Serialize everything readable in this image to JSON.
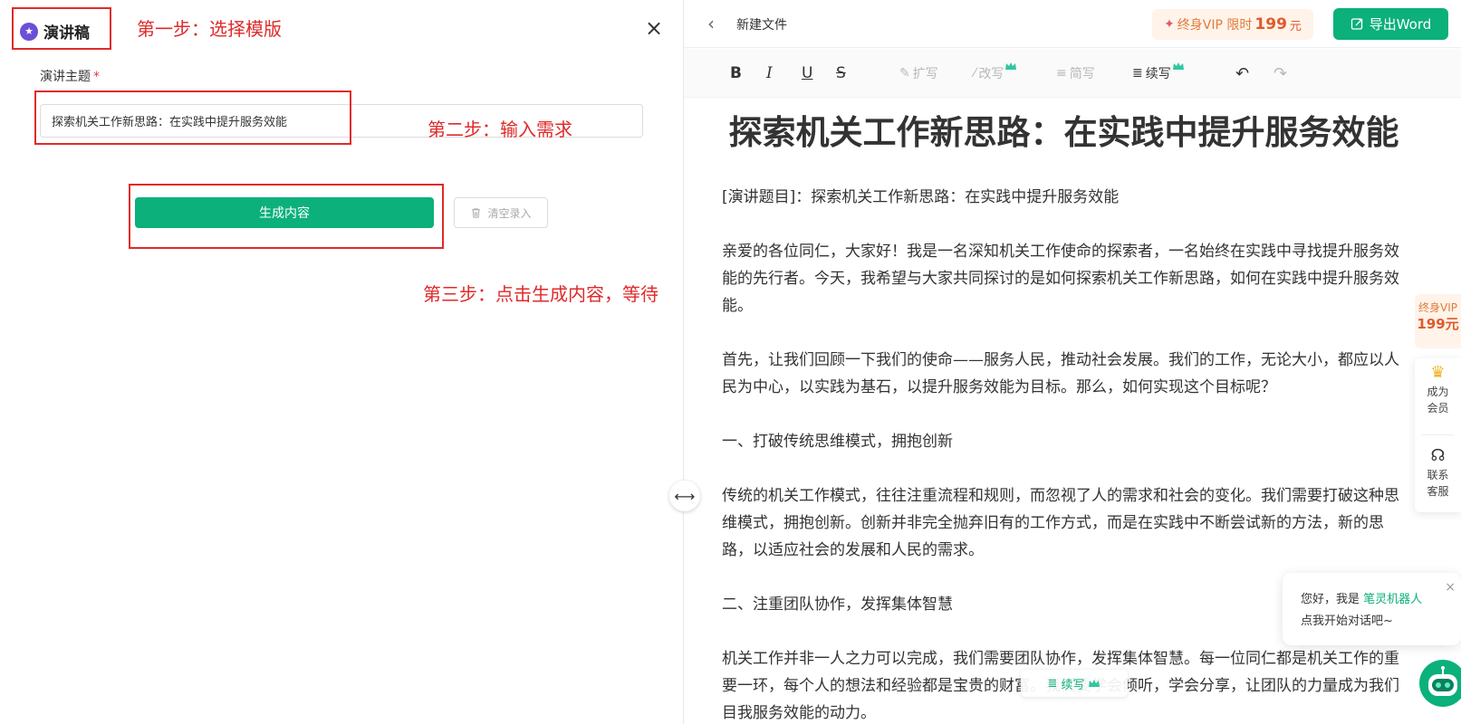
{
  "left_panel": {
    "brand": "演讲稿",
    "field_label": "演讲主题",
    "required_mark": "*",
    "topic_value": "探索机关工作新思路：在实践中提升服务效能",
    "generate_label": "生成内容",
    "clear_label": "清空录入"
  },
  "annotations": {
    "step1": "第一步：选择模版",
    "step2": "第二步：输入需求",
    "step3": "第三步：点击生成内容，等待"
  },
  "topbar": {
    "doc_title": "新建文件",
    "vip_text": "终身VIP 限时",
    "vip_price": "199",
    "vip_unit": "元",
    "export_label": "导出Word"
  },
  "toolbar": {
    "bold": "B",
    "italic": "I",
    "underline": "U",
    "strike": "S",
    "expand": "扩写",
    "rewrite": "改写",
    "shorten": "简写",
    "continue": "续写"
  },
  "document": {
    "title": "探索机关工作新思路：在实践中提升服务效能",
    "paragraphs": [
      "[演讲题目]：探索机关工作新思路：在实践中提升服务效能",
      "亲爱的各位同仁，大家好！我是一名深知机关工作使命的探索者，一名始终在实践中寻找提升服务效能的先行者。今天，我希望与大家共同探讨的是如何探索机关工作新思路，如何在实践中提升服务效能。",
      "首先，让我们回顾一下我们的使命——服务人民，推动社会发展。我们的工作，无论大小，都应以人民为中心，以实践为基石，以提升服务效能为目标。那么，如何实现这个目标呢？",
      "一、打破传统思维模式，拥抱创新",
      "传统的机关工作模式，往往注重流程和规则，而忽视了人的需求和社会的变化。我们需要打破这种思维模式，拥抱创新。创新并非完全抛弃旧有的工作方式，而是在实践中不断尝试新的方法，新的思路，以适应社会的发展和人民的需求。",
      "二、注重团队协作，发挥集体智慧",
      "机关工作并非一人之力可以完成，我们需要团队协作，发挥集体智慧。每一位同仁都是机关工作的重要一环，每个人的想法和经验都是宝贵的财富。我们要学会倾听，学会分享，让团队的力量成为我们目我服务效能的动力。"
    ]
  },
  "floating": {
    "vip_line1": "终身VIP",
    "vip_price": "199元",
    "member_line1": "成为",
    "member_line2": "会员",
    "service_line1": "联系",
    "service_line2": "客服",
    "chat_greeting": "您好，我是",
    "chat_name": "笔灵机器人",
    "chat_line2": "点我开始对话吧~",
    "continue_chip": "续写"
  },
  "colors": {
    "accent": "#0bb07b",
    "annotation_red": "#e02a2a",
    "vip_orange": "#e07b39",
    "brand_purple": "#6b4fd8"
  }
}
